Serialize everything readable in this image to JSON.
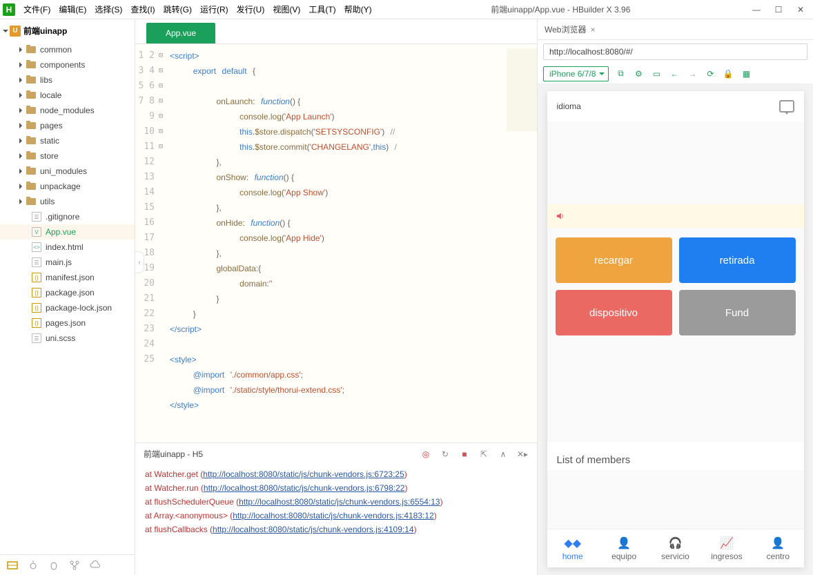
{
  "window": {
    "title": "前端uinapp/App.vue - HBuilder X 3.96"
  },
  "menu": [
    "文件(F)",
    "编辑(E)",
    "选择(S)",
    "查找(I)",
    "跳转(G)",
    "运行(R)",
    "发行(U)",
    "视图(V)",
    "工具(T)",
    "帮助(Y)"
  ],
  "project": {
    "name": "前端uinapp",
    "folders": [
      "common",
      "components",
      "libs",
      "locale",
      "node_modules",
      "pages",
      "static",
      "store",
      "uni_modules",
      "unpackage",
      "utils"
    ],
    "files": [
      {
        "n": ".gitignore",
        "t": "txt"
      },
      {
        "n": "App.vue",
        "t": "vue",
        "sel": true
      },
      {
        "n": "index.html",
        "t": "html"
      },
      {
        "n": "main.js",
        "t": "txt"
      },
      {
        "n": "manifest.json",
        "t": "br"
      },
      {
        "n": "package.json",
        "t": "br"
      },
      {
        "n": "package-lock.json",
        "t": "br"
      },
      {
        "n": "pages.json",
        "t": "br"
      },
      {
        "n": "uni.scss",
        "t": "txt"
      }
    ]
  },
  "tab": {
    "label": "App.vue"
  },
  "code": {
    "lines": 25,
    "foldable": [
      1,
      2,
      4,
      9,
      12,
      15,
      21
    ],
    "c": {
      "s_app_launch": "'App Launch'",
      "s_setsys": "'SETSYSCONFIG'",
      "s_changel": "'CHANGELANG'",
      "s_app_show": "'App Show'",
      "s_app_hide": "'App Hide'",
      "s_dom": "''",
      "s_css1": "'./common/app.css'",
      "s_css2": "'./static/style/thorui-extend.css'"
    }
  },
  "console": {
    "title": "前端uinapp - H5",
    "rows": [
      {
        "pre": "   at Watcher.get (",
        "url": "http://localhost:8080/static/js/chunk-vendors.js:6723:25",
        "post": ")"
      },
      {
        "pre": "   at Watcher.run (",
        "url": "http://localhost:8080/static/js/chunk-vendors.js:6798:22",
        "post": ")"
      },
      {
        "pre": "   at flushSchedulerQueue (",
        "url": "http://localhost:8080/static/js/chunk-vendors.js:6554:13",
        "post": ")"
      },
      {
        "pre": "   at Array.<anonymous> (",
        "url": "http://localhost:8080/static/js/chunk-vendors.js:4183:12",
        "post": ")"
      },
      {
        "pre": "   at flushCallbacks (",
        "url": "http://localhost:8080/static/js/chunk-vendors.js:4109:14",
        "post": ")"
      }
    ]
  },
  "browser": {
    "tab": "Web浏览器",
    "url": "http://localhost:8080/#/",
    "device": "iPhone 6/7/8"
  },
  "preview": {
    "header": "idioma",
    "btn1": "recargar",
    "btn2": "retirada",
    "btn3": "dispositivo",
    "btn4": "Fund",
    "members": "List of members",
    "nav": [
      "home",
      "equipo",
      "servicio",
      "ingresos",
      "centro"
    ]
  }
}
